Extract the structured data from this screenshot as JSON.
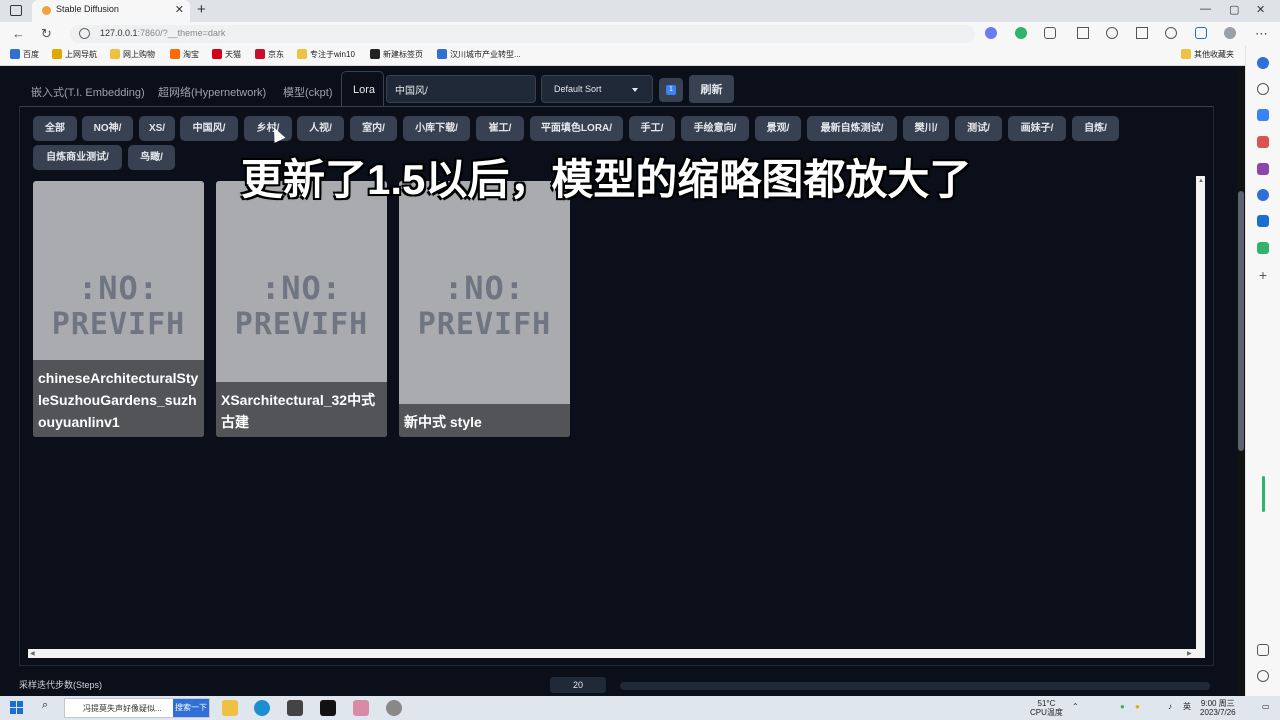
{
  "browser": {
    "tab_title": "Stable Diffusion",
    "tab_close": "✕",
    "new_tab": "+",
    "window_controls": [
      "—",
      "▢",
      "✕"
    ],
    "url_host": "127.0.0.1",
    "url_rest": ":7860/?__theme=dark",
    "bookmarks": [
      "百度",
      "上网导航",
      "网上购物",
      "淘宝",
      "天猫",
      "京东",
      "专注于win10",
      "新建标签页",
      "汉川城市产业转型...",
      "其他收藏夹"
    ]
  },
  "app": {
    "tabs": [
      {
        "label": "嵌入式(T.I. Embedding)"
      },
      {
        "label": "超网络(Hypernetwork)"
      },
      {
        "label": "模型(ckpt)"
      },
      {
        "label": "Lora"
      }
    ],
    "search_value": "中国风/",
    "sort_value": "Default Sort",
    "sort_dir_glyph": "1",
    "refresh_label": "刷新",
    "filters": [
      "全部",
      "NO神/",
      "XS/",
      "中国风/",
      "乡村/",
      "人视/",
      "室内/",
      "小库下载/",
      "崔工/",
      "平面填色LORA/",
      "手工/",
      "手绘意向/",
      "景观/",
      "最新自炼测试/",
      "樊川/",
      "测试/",
      "画妹子/",
      "自炼/",
      "自炼商业测试/",
      "鸟瞰/"
    ],
    "cards": [
      {
        "name": "chineseArchitecturalStyleSuzhouGardens_suzhouyuanlinv1",
        "preview_line1": ":NO:",
        "preview_line2": "PREVIFH"
      },
      {
        "name": "XSarchitectural_32中式古建",
        "preview_line1": ":NO:",
        "preview_line2": "PREVIFH"
      },
      {
        "name": "新中式 style",
        "preview_line1": ":NO:",
        "preview_line2": "PREVIFH"
      }
    ],
    "overlay_caption": "更新了1.5以后，模型的缩略图都放大了",
    "steps_label": "采样迭代步数(Steps)",
    "steps_value": "20"
  },
  "taskbar": {
    "search_text": "冯提莫失声好像疑似...",
    "search_button": "搜索一下",
    "weather_temp": "51°C",
    "weather_label": "CPU温度",
    "ime": "英",
    "time": "9:00 周三",
    "date": "2023/7/26"
  },
  "colors": {
    "page_bg": "#0b0f19",
    "chip_bg": "#374151",
    "card_bg": "#a9abaf"
  }
}
